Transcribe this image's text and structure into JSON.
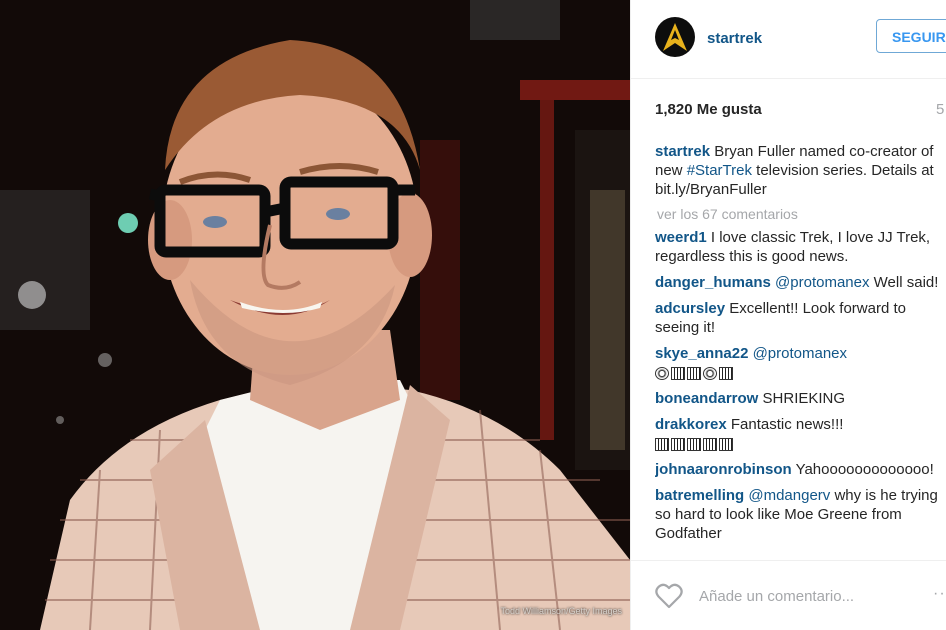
{
  "photo": {
    "credit": "Todd Williamson/Getty Images"
  },
  "header": {
    "username": "startrek",
    "follow_label": "SEGUIR",
    "avatar_icon": "star-trek-delta-icon"
  },
  "stats": {
    "likes": "1,820 Me gusta",
    "time": "5"
  },
  "caption": {
    "user": "startrek",
    "text_1": "Bryan Fuller named co-creator of new ",
    "hashtag": "#StarTrek",
    "text_2": " television series. Details at bit.ly/BryanFuller"
  },
  "view_all": "ver los 67 comentarios",
  "comments": [
    {
      "user": "weerd1",
      "text": "I love classic Trek, I love JJ Trek, regardless this is good news."
    },
    {
      "user": "danger_humans",
      "mention": "@protomanex",
      "text": " Well said!"
    },
    {
      "user": "adcursley",
      "text": "Excellent!! Look forward to seeing it!"
    },
    {
      "user": "skye_anna22",
      "mention": "@protomanex",
      "text": ""
    },
    {
      "user": "boneandarrow",
      "text": "SHRIEKING"
    },
    {
      "user": "drakkorex",
      "text": "Fantastic news!!!"
    },
    {
      "user": "johnaaronrobinson",
      "text": "Yahooooooooooooo!"
    },
    {
      "user": "batremelling",
      "mention": "@mdangerv",
      "text": " why is he trying so hard to look like Moe Greene from Godfather"
    }
  ],
  "footer": {
    "placeholder": "Añade un comentario...",
    "more_label": "···"
  },
  "colors": {
    "link": "#125688",
    "button": "#3897f0",
    "muted": "#a5a7aa"
  }
}
